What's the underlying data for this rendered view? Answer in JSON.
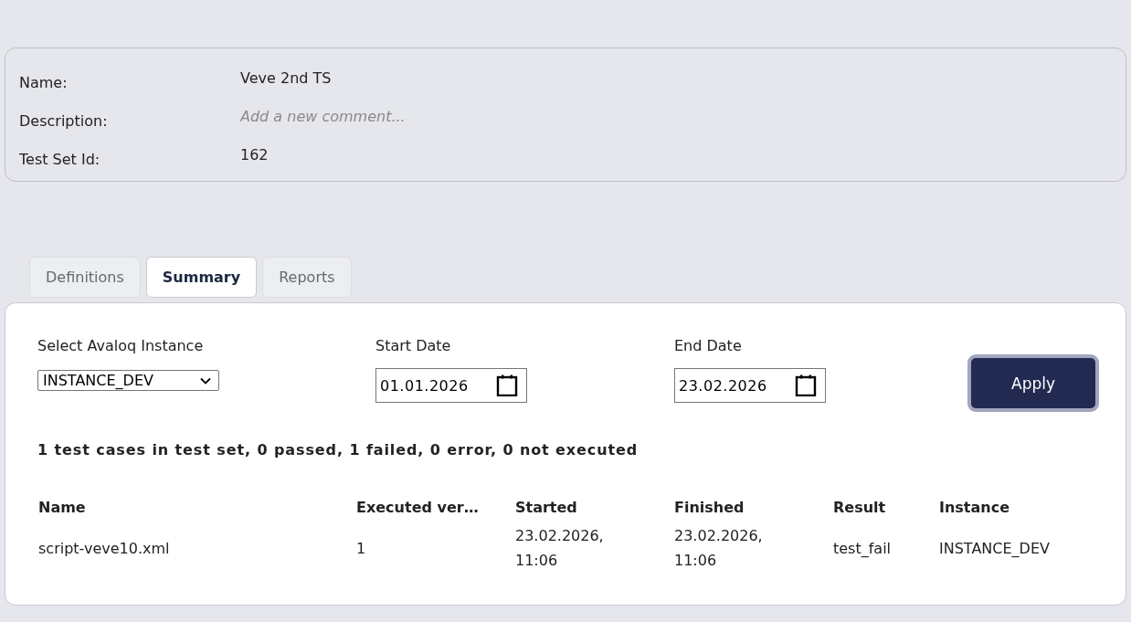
{
  "details": {
    "fields": [
      {
        "label": "Name:",
        "value": "Veve 2nd TS"
      },
      {
        "label": "Description:",
        "placeholder": "Add a new comment..."
      },
      {
        "label": "Test Set Id:",
        "value": "162"
      }
    ]
  },
  "tabs": [
    {
      "label": "Definitions",
      "selected": false
    },
    {
      "label": "Summary",
      "selected": true
    },
    {
      "label": "Reports",
      "selected": false
    }
  ],
  "filters": {
    "instance": {
      "label": "Select Avaloq Instance",
      "value": "INSTANCE_DEV"
    },
    "start_date": {
      "label": "Start Date",
      "value": "01.01.2026"
    },
    "end_date": {
      "label": "End Date",
      "value": "23.02.2026"
    },
    "apply_button": "Apply"
  },
  "summary": "1 test cases in test set, 0 passed, 1 failed, 0 error, 0 not executed",
  "table": {
    "columns": [
      "Name",
      "Executed ver…",
      "Started",
      "Finished",
      "Result",
      "Instance"
    ],
    "rows": [
      [
        "script-veve10.xml",
        "1",
        "23.02.2026, 11:06",
        "23.02.2026, 11:06",
        "test_fail",
        "INSTANCE_DEV"
      ]
    ]
  }
}
